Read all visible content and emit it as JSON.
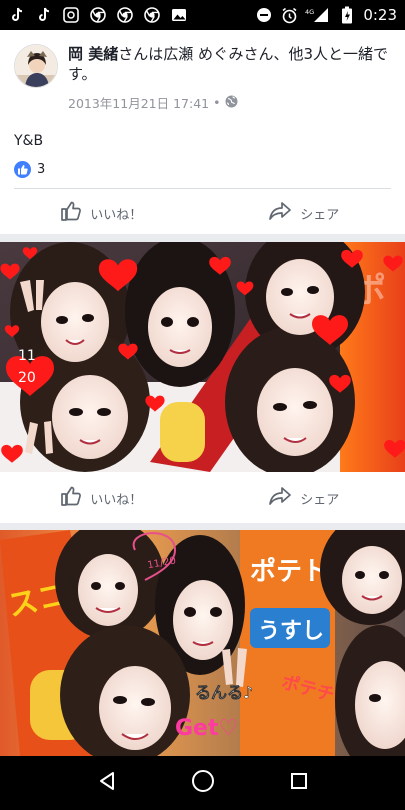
{
  "status_bar": {
    "time": "0:23",
    "network": "4G",
    "icons_left": [
      "tiktok-icon",
      "tiktok-icon",
      "music-icon",
      "chrome-icon",
      "chrome-icon",
      "chrome-icon",
      "gallery-icon"
    ],
    "icons_right": [
      "dnd-icon",
      "alarm-icon",
      "signal-icon",
      "battery-icon"
    ]
  },
  "post": {
    "author": "岡 美緒",
    "header_text": "さんは広瀬 めぐみさん、他3人と一緒です。",
    "timestamp": "2013年11月21日 17:41",
    "privacy_separator": "•",
    "body": "Y&B",
    "like_count": "3"
  },
  "actions": {
    "like_label": "いいね！",
    "share_label": "シェア"
  },
  "photo1_overlay": {
    "date_line1": "11",
    "date_line2": "20"
  },
  "photo2_overlay": {
    "caption": "Get♡",
    "product_text": "うすし",
    "small_date": "11/20"
  },
  "colors": {
    "facebook_blue": "#4080ff",
    "heart_red": "#ff1a1a"
  }
}
